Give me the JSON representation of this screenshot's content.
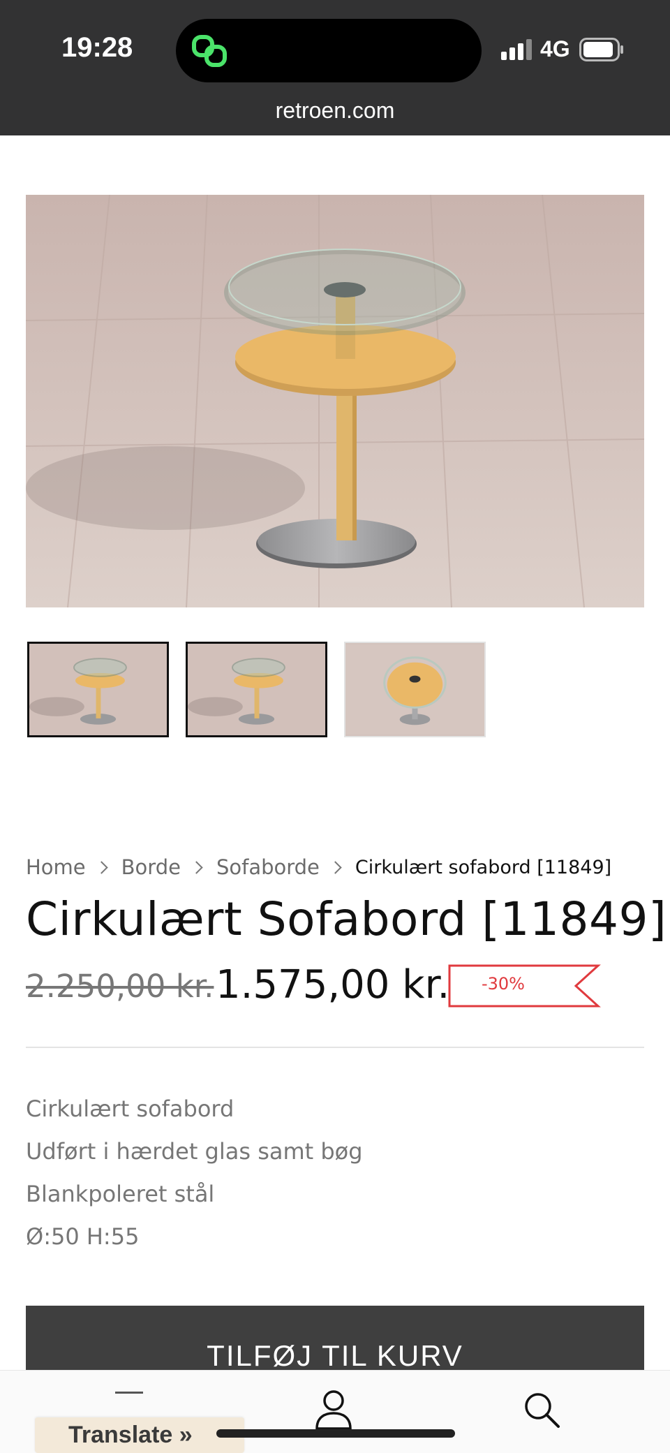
{
  "status_bar": {
    "time": "19:28",
    "network": "4G",
    "url": "retroen.com",
    "app_icon": "chain-link-icon"
  },
  "product": {
    "breadcrumb": [
      "Home",
      "Borde",
      "Sofaborde",
      "Cirkulært sofabord [11849]"
    ],
    "title": "Cirkulært Sofabord [11849]",
    "old_price": "2.250,00 kr.",
    "new_price": "1.575,00 kr.",
    "discount": "-30%",
    "description": [
      "Cirkulært sofabord",
      "Udført i hærdet glas samt bøg",
      "Blankpoleret stål",
      "Ø:50 H:55"
    ],
    "add_to_cart_label": "TILFØJ TIL KURV"
  },
  "gallery": {
    "thumbnails": [
      "thumbnail-side-view",
      "thumbnail-side-view-2",
      "thumbnail-top-view"
    ]
  },
  "bottom_bar": {
    "translate_label": "Translate »",
    "icons": [
      "user-icon",
      "search-icon"
    ]
  },
  "colors": {
    "status_bar": "#323233",
    "discount_red": "#e03a3e",
    "button": "#3f3f3f"
  }
}
